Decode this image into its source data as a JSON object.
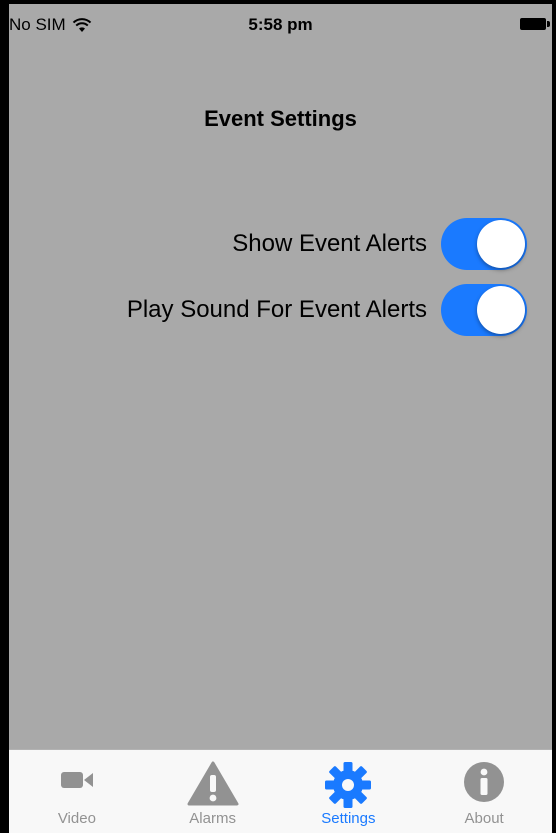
{
  "status_bar": {
    "carrier": "No SIM",
    "time": "5:58 pm"
  },
  "page": {
    "title": "Event Settings"
  },
  "settings": [
    {
      "label": "Show Event Alerts",
      "enabled": true
    },
    {
      "label": "Play Sound For Event Alerts",
      "enabled": true
    }
  ],
  "tab_bar": {
    "tabs": [
      {
        "label": "Video",
        "icon": "video-camera-icon",
        "active": false
      },
      {
        "label": "Alarms",
        "icon": "warning-icon",
        "active": false
      },
      {
        "label": "Settings",
        "icon": "gear-icon",
        "active": true
      },
      {
        "label": "About",
        "icon": "info-icon",
        "active": false
      }
    ]
  },
  "colors": {
    "accent": "#1a7aff",
    "background": "#a9a9a9",
    "tab_inactive": "#929292"
  }
}
